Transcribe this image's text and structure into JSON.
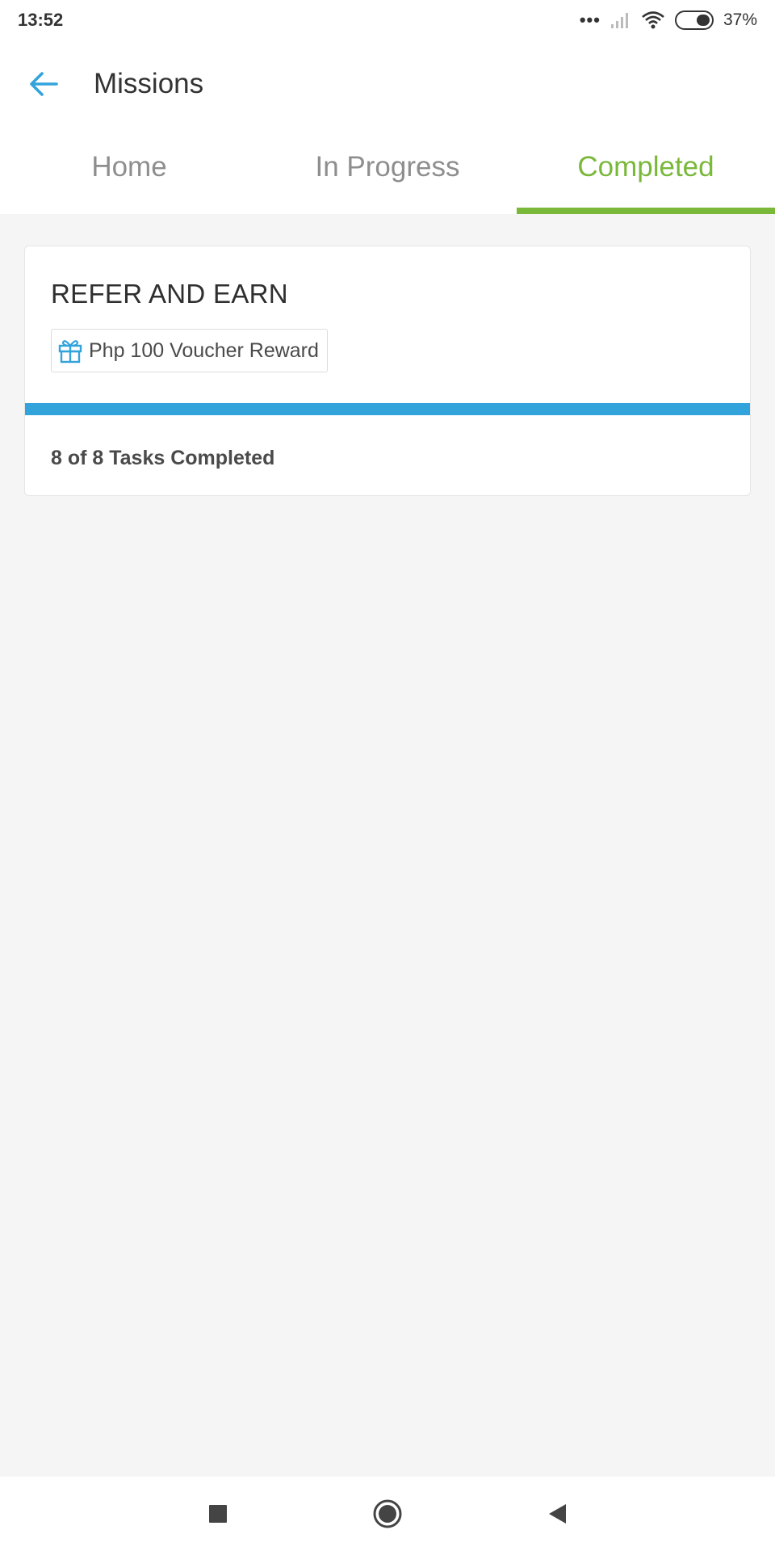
{
  "status_bar": {
    "time": "13:52",
    "signal_dots": "•••",
    "battery_percent": "37%"
  },
  "app_bar": {
    "title": "Missions"
  },
  "tabs": [
    {
      "label": "Home",
      "active": false
    },
    {
      "label": "In Progress",
      "active": false
    },
    {
      "label": "Completed",
      "active": true
    }
  ],
  "mission_card": {
    "title": "REFER AND EARN",
    "reward_label": "Php 100 Voucher Reward",
    "tasks_completed": 8,
    "tasks_total": 8,
    "status_text": "8 of 8 Tasks Completed",
    "progress_fraction": 1.0
  },
  "colors": {
    "accent_green": "#7ab83a",
    "accent_blue": "#33a3dc",
    "background": "#f5f5f5"
  },
  "icons": {
    "back": "arrow-left-icon",
    "reward": "gift-icon",
    "nav_recents": "square-icon",
    "nav_home": "circle-icon",
    "nav_back": "triangle-back-icon"
  }
}
